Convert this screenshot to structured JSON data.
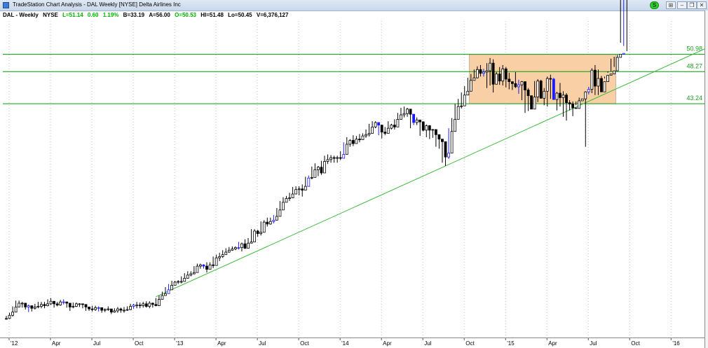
{
  "window": {
    "title": "TradeStation Chart Analysis - DAL Weekly [NYSE] Delta Airlines Inc",
    "status_icon": "S"
  },
  "info": {
    "symbol": "DAL - Weekly",
    "exchange": "NYSE",
    "last": "L=51.14",
    "change": "0.60",
    "pct": "1.19%",
    "bid": "B=33.19",
    "ask": "A=56.00",
    "open": "O=50.53",
    "high": "HI=51.48",
    "low": "Lo=50.45",
    "volume": "V=6,376,127"
  },
  "colors": {
    "bar": "#000000",
    "bar_blue": "#1a1aff",
    "line": "#00a000",
    "zone": "#f9cfa6",
    "grid": "#c0c0c0"
  },
  "chart_data": {
    "type": "line",
    "title": "",
    "xlabel": "",
    "ylabel": "",
    "x_ticks": [
      "'12",
      "Apr",
      "Jul",
      "Oct",
      "'13",
      "Apr",
      "Jul",
      "Oct",
      "'14",
      "Apr",
      "Jul",
      "Oct",
      "'15",
      "Apr",
      "Jul",
      "Oct",
      "'16"
    ],
    "ylim": [
      7.5,
      56.2
    ],
    "grid": "vertical dotted",
    "horizontal_levels": [
      {
        "label": "50.98",
        "value": 50.98
      },
      {
        "label": "48.27",
        "value": 48.27
      },
      {
        "label": "43.24",
        "value": 43.24
      }
    ],
    "box": {
      "x_start": 145.5,
      "x_end": 191.5,
      "y_low": 43.24,
      "y_high": 50.98
    },
    "trendline": {
      "points": [
        [
          47,
          13.0
        ],
        [
          226.4,
          53.4
        ]
      ]
    },
    "series": [
      {
        "type": "ohlc",
        "x": [
          0,
          1,
          2,
          3,
          4,
          5,
          6,
          7,
          8,
          9,
          10,
          11,
          12,
          13,
          14,
          15,
          16,
          17,
          18,
          19,
          20,
          21,
          22,
          23,
          24,
          25,
          26,
          27,
          28,
          29,
          30,
          31,
          32,
          33,
          34,
          35,
          36,
          37,
          38,
          39,
          40,
          41,
          42,
          43,
          44,
          45,
          46,
          47,
          48,
          49,
          50,
          51,
          52,
          53,
          54,
          55,
          56,
          57,
          58,
          59,
          60,
          61,
          62,
          63,
          64,
          65,
          66,
          67,
          68,
          69,
          70,
          71,
          72,
          73,
          74,
          75,
          76,
          77,
          78,
          79,
          80,
          81,
          82,
          83,
          84,
          85,
          86,
          87,
          88,
          89,
          90,
          91,
          92,
          93,
          94,
          95,
          96,
          97,
          98,
          99,
          100,
          101,
          102,
          103,
          104,
          105,
          106,
          107,
          108,
          109,
          110,
          111,
          112,
          113,
          114,
          115,
          116,
          117,
          118,
          119,
          120,
          121,
          122,
          123,
          124,
          125,
          126,
          127,
          128,
          129,
          130,
          131,
          132,
          133,
          134,
          135,
          136,
          137,
          138,
          139,
          140,
          141,
          142,
          143,
          144,
          145,
          146,
          147,
          148,
          149,
          150,
          151,
          152,
          153,
          154,
          155,
          156,
          157,
          158,
          159,
          160,
          161,
          162,
          163,
          164,
          165,
          166,
          167,
          168,
          169,
          170,
          171,
          172,
          173,
          174,
          175,
          176,
          177,
          178,
          179,
          180,
          181,
          182,
          183,
          184,
          185,
          186,
          187,
          188,
          189,
          190,
          191,
          192,
          193,
          194,
          195,
          196
        ],
        "close": [
          9.6,
          10.1,
          10.6,
          11.4,
          12.0,
          12.0,
          11.4,
          11.6,
          11.2,
          11.4,
          11.5,
          11.8,
          11.6,
          11.9,
          12.3,
          11.9,
          11.7,
          12.2,
          12.2,
          12.0,
          11.4,
          11.5,
          11.9,
          11.9,
          11.8,
          11.4,
          11.1,
          11.0,
          11.3,
          11.3,
          10.9,
          11.0,
          11.1,
          10.6,
          10.8,
          11.1,
          10.9,
          10.9,
          11.0,
          11.5,
          11.7,
          11.7,
          11.6,
          11.9,
          11.5,
          12.0,
          11.8,
          11.6,
          12.6,
          13.2,
          13.5,
          14.1,
          14.8,
          15.3,
          15.4,
          15.4,
          15.9,
          16.4,
          16.6,
          16.8,
          17.8,
          18.0,
          17.8,
          17.3,
          18.0,
          17.9,
          19.1,
          19.3,
          19.6,
          20.0,
          20.3,
          20.5,
          20.7,
          20.7,
          21.3,
          20.6,
          21.4,
          21.6,
          23.3,
          22.9,
          23.1,
          24.7,
          24.4,
          24.8,
          25.0,
          25.6,
          26.6,
          27.8,
          28.4,
          28.5,
          29.1,
          29.8,
          29.9,
          29.7,
          30.3,
          31.6,
          31.7,
          32.9,
          33.3,
          32.4,
          34.2,
          34.5,
          34.8,
          34.7,
          34.8,
          34.7,
          35.3,
          36.9,
          37.5,
          37.0,
          37.7,
          37.6,
          38.2,
          38.4,
          38.6,
          39.6,
          40.3,
          39.9,
          38.8,
          38.6,
          39.4,
          39.9,
          39.6,
          40.8,
          41.5,
          41.7,
          42.4,
          41.6,
          40.3,
          40.7,
          40.4,
          39.1,
          39.8,
          39.1,
          39.2,
          38.4,
          37.7,
          37.3,
          34.9,
          35.5,
          38.9,
          40.8,
          42.8,
          42.9,
          44.6,
          45.2,
          46.9,
          47.3,
          48.6,
          48.0,
          48.2,
          48.4,
          49.6,
          46.3,
          47.9,
          46.8,
          48.7,
          47.1,
          46.7,
          46.4,
          45.9,
          46.2,
          46.7,
          45.4,
          44.5,
          42.4,
          44.3,
          46.8,
          44.1,
          45.2,
          47.2,
          47.1,
          43.9,
          44.9,
          44.2,
          44.6,
          43.4,
          43.2,
          42.6,
          42.5,
          43.7,
          44.0,
          45.1,
          45.5,
          48.5,
          46.0,
          47.2,
          45.1,
          46.7,
          47.7,
          47.9,
          48.4,
          50.5,
          51.0,
          51.14
        ],
        "high": [
          10.0,
          10.5,
          11.5,
          12.4,
          12.4,
          12.2,
          11.8,
          11.8,
          11.5,
          11.9,
          12.2,
          12.2,
          12.2,
          12.6,
          12.8,
          12.3,
          12.2,
          12.5,
          12.6,
          12.2,
          11.7,
          12.1,
          12.1,
          12.0,
          11.9,
          11.8,
          11.4,
          11.6,
          11.6,
          11.5,
          11.3,
          11.2,
          11.5,
          11.0,
          11.2,
          11.4,
          11.3,
          11.4,
          11.5,
          11.9,
          11.9,
          12.2,
          12.1,
          12.2,
          12.3,
          12.3,
          12.1,
          12.8,
          13.2,
          13.8,
          14.5,
          15.0,
          15.5,
          15.5,
          15.6,
          16.2,
          16.7,
          17.0,
          17.0,
          17.8,
          18.2,
          18.2,
          18.1,
          18.4,
          18.4,
          19.3,
          19.6,
          19.9,
          20.3,
          20.6,
          20.8,
          20.9,
          20.9,
          21.6,
          21.5,
          22.0,
          22.2,
          23.6,
          23.6,
          23.5,
          24.8,
          25.0,
          25.4,
          25.4,
          25.8,
          26.9,
          28.0,
          28.6,
          28.8,
          29.3,
          30.2,
          30.3,
          30.3,
          30.6,
          31.8,
          32.0,
          33.4,
          33.9,
          33.5,
          34.3,
          35.1,
          35.3,
          35.2,
          35.1,
          35.1,
          35.8,
          37.2,
          38.0,
          37.7,
          38.3,
          38.2,
          38.5,
          38.6,
          39.2,
          40.1,
          40.5,
          40.5,
          40.3,
          39.7,
          39.6,
          40.5,
          40.1,
          40.8,
          41.8,
          42.6,
          42.8,
          42.6,
          41.8,
          41.4,
          41.1,
          40.4,
          40.5,
          40.0,
          39.9,
          39.3,
          38.4,
          38.1,
          37.6,
          35.9,
          39.4,
          41.0,
          43.2,
          44.0,
          45.0,
          46.0,
          47.3,
          47.9,
          48.6,
          49.1,
          49.3,
          48.7,
          49.6,
          50.4,
          50.2,
          48.2,
          49.0,
          49.3,
          49.0,
          48.1,
          46.6,
          48.2,
          47.0,
          46.8,
          46.1,
          45.7,
          44.3,
          46.8,
          47.1,
          47.0,
          45.7,
          47.5,
          47.8,
          47.3,
          45.1,
          46.5,
          45.2,
          44.9,
          43.8,
          43.6,
          43.0,
          44.2,
          44.8,
          45.2,
          45.9,
          48.8,
          49.3,
          48.6,
          47.6,
          47.2,
          48.1,
          48.3,
          49.0,
          50.9,
          52.8,
          52.3,
          51.48
        ],
        "low": [
          9.4,
          9.5,
          9.9,
          10.7,
          11.4,
          11.3,
          11.0,
          10.6,
          10.7,
          11.0,
          11.2,
          11.2,
          11.2,
          11.5,
          11.7,
          11.3,
          11.5,
          11.6,
          11.8,
          11.3,
          10.8,
          11.2,
          11.4,
          11.4,
          11.2,
          10.8,
          10.8,
          10.7,
          10.8,
          10.7,
          10.5,
          10.6,
          10.8,
          10.3,
          10.5,
          10.5,
          10.5,
          10.5,
          10.8,
          10.9,
          11.1,
          11.2,
          11.2,
          11.3,
          11.3,
          11.2,
          11.3,
          11.5,
          12.3,
          12.7,
          13.2,
          13.7,
          14.5,
          14.9,
          15.0,
          15.1,
          15.5,
          16.0,
          16.2,
          16.5,
          17.2,
          17.4,
          17.4,
          16.8,
          17.3,
          17.5,
          18.7,
          18.6,
          19.1,
          19.6,
          19.9,
          20.2,
          20.3,
          20.4,
          20.1,
          20.5,
          21.0,
          21.5,
          22.6,
          22.4,
          22.6,
          24.1,
          24.0,
          24.3,
          24.5,
          25.0,
          26.2,
          27.0,
          27.8,
          28.0,
          28.8,
          29.4,
          28.9,
          28.7,
          29.7,
          30.9,
          31.4,
          32.1,
          31.9,
          32.1,
          33.7,
          33.8,
          34.0,
          34.0,
          34.0,
          34.4,
          35.0,
          36.6,
          36.5,
          36.6,
          37.2,
          37.2,
          37.6,
          37.9,
          38.1,
          39.2,
          39.4,
          38.3,
          37.8,
          38.3,
          39.1,
          39.2,
          39.2,
          40.5,
          41.3,
          41.1,
          41.2,
          39.4,
          39.9,
          39.9,
          38.2,
          38.9,
          38.0,
          37.7,
          37.9,
          36.5,
          36.2,
          34.0,
          33.5,
          34.6,
          38.6,
          40.6,
          42.2,
          42.5,
          44.3,
          44.8,
          46.6,
          47.2,
          47.2,
          47.5,
          47.5,
          45.7,
          46.1,
          45.0,
          46.5,
          46.2,
          46.1,
          45.8,
          45.5,
          45.4,
          45.7,
          44.8,
          43.8,
          41.8,
          42.1,
          44.0,
          43.4,
          43.5,
          44.9,
          43.0,
          42.8,
          44.0,
          43.9,
          42.2,
          42.8,
          41.2,
          40.6,
          42.2,
          41.3,
          43.6,
          43.6,
          44.8,
          36.5,
          44.7,
          44.9,
          44.6,
          44.6,
          46.4,
          47.5,
          48.3,
          50.3,
          50.6,
          50.45
        ]
      }
    ]
  }
}
